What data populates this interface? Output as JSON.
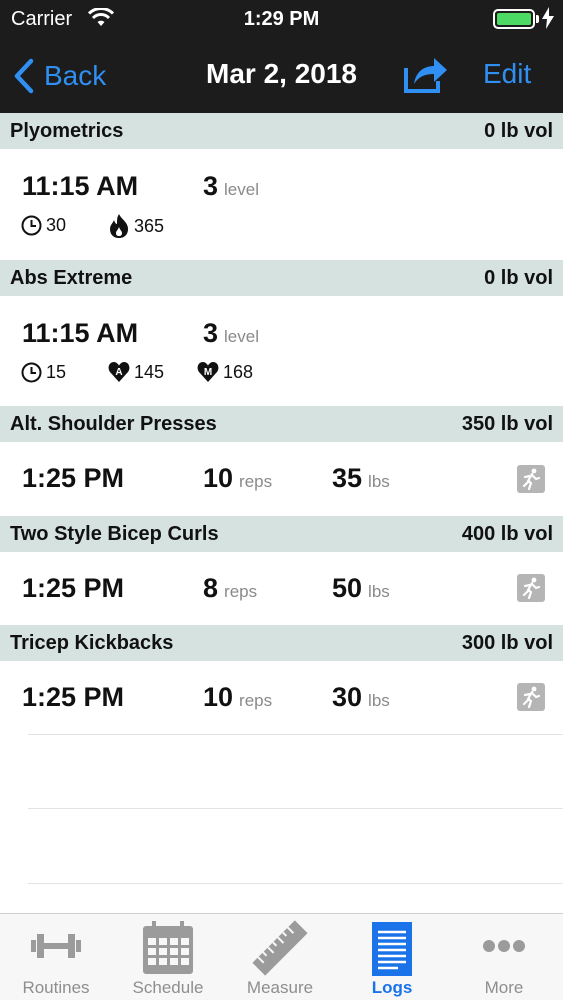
{
  "status_bar": {
    "carrier": "Carrier",
    "time": "1:29 PM",
    "battery_color": "#4cd964"
  },
  "nav": {
    "back_label": "Back",
    "title": "Mar 2, 2018",
    "edit_label": "Edit",
    "accent": "#2f8ff2"
  },
  "entries": [
    {
      "name": "Plyometrics",
      "volume": "0 lb vol",
      "time": "11:15 AM",
      "level": "3",
      "level_unit": "level",
      "duration": "30",
      "calories": "365"
    },
    {
      "name": "Abs Extreme",
      "volume": "0 lb vol",
      "time": "11:15 AM",
      "level": "3",
      "level_unit": "level",
      "duration": "15",
      "avg_hr": "145",
      "max_hr": "168",
      "avg_badge": "A",
      "max_badge": "M"
    },
    {
      "name": "Alt. Shoulder Presses",
      "volume": "350 lb vol",
      "time": "1:25 PM",
      "reps": "10",
      "reps_unit": "reps",
      "weight": "35",
      "weight_unit": "lbs"
    },
    {
      "name": "Two Style Bicep Curls",
      "volume": "400 lb vol",
      "time": "1:25 PM",
      "reps": "8",
      "reps_unit": "reps",
      "weight": "50",
      "weight_unit": "lbs"
    },
    {
      "name": "Tricep Kickbacks",
      "volume": "300 lb vol",
      "time": "1:25 PM",
      "reps": "10",
      "reps_unit": "reps",
      "weight": "30",
      "weight_unit": "lbs"
    }
  ],
  "tabs": [
    {
      "label": "Routines",
      "icon": "dumbbell-icon",
      "active": false
    },
    {
      "label": "Schedule",
      "icon": "calendar-icon",
      "active": false
    },
    {
      "label": "Measure",
      "icon": "ruler-icon",
      "active": false
    },
    {
      "label": "Logs",
      "icon": "document-icon",
      "active": true
    },
    {
      "label": "More",
      "icon": "more-dots-icon",
      "active": false
    }
  ],
  "active_tab_color": "#1a73e8"
}
